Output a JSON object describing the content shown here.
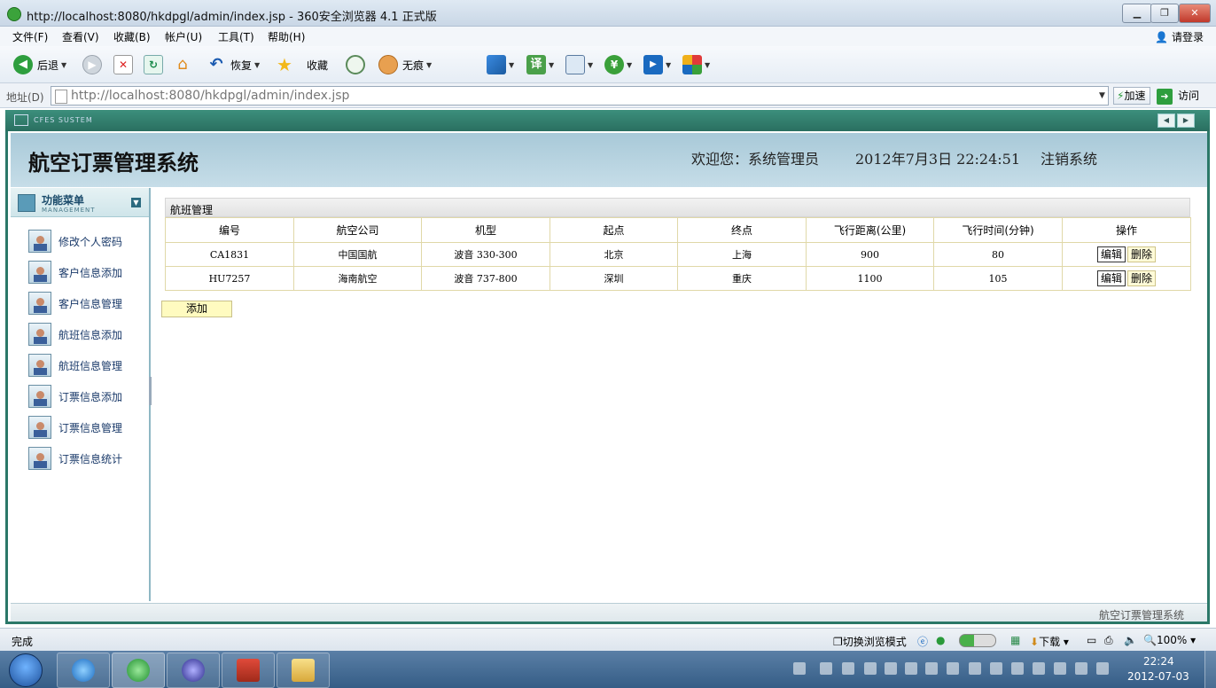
{
  "browser": {
    "title": "http://localhost:8080/hkdpgl/admin/index.jsp - 360安全浏览器 4.1 正式版",
    "menu": [
      "文件(F)",
      "查看(V)",
      "收藏(B)",
      "帐户(U)",
      "工具(T)",
      "帮助(H)"
    ],
    "login": "请登录",
    "toolbar": {
      "back": "后退",
      "restore": "恢复",
      "favorites": "收藏",
      "incognito": "无痕",
      "translate": "译"
    },
    "address_label": "地址(D)",
    "address_value": "http://localhost:8080/hkdpgl/admin/index.jsp",
    "speed": "加速",
    "visit": "访问",
    "status": "完成",
    "status_mode": "切换浏览模式",
    "download": "下载",
    "zoom": "100%"
  },
  "app": {
    "system_label": "CFES SUSTEM",
    "title": "航空订票管理系统",
    "welcome": "欢迎您：系统管理员",
    "datetime": "2012年7月3日  22:24:51",
    "logout": "注销系统",
    "footer": "航空订票管理系统"
  },
  "sidebar": {
    "title": "功能菜单",
    "subtitle": "MANAGEMENT",
    "items": [
      "修改个人密码",
      "客户信息添加",
      "客户信息管理",
      "航班信息添加",
      "航班信息管理",
      "订票信息添加",
      "订票信息管理",
      "订票信息统计"
    ]
  },
  "main": {
    "section_title": "航班管理",
    "columns": [
      "编号",
      "航空公司",
      "机型",
      "起点",
      "终点",
      "飞行距离(公里)",
      "飞行时间(分钟)",
      "操作"
    ],
    "rows": [
      {
        "id": "CA1831",
        "airline": "中国国航",
        "model": "波音  330-300",
        "from": "北京",
        "to": "上海",
        "distance": "900",
        "time": "80"
      },
      {
        "id": "HU7257",
        "airline": "海南航空",
        "model": "波音  737-800",
        "from": "深圳",
        "to": "重庆",
        "distance": "1100",
        "time": "105"
      }
    ],
    "edit_label": "编辑",
    "delete_label": "删除",
    "add_label": "添加"
  },
  "taskbar": {
    "time": "22:24",
    "date": "2012-07-03"
  }
}
